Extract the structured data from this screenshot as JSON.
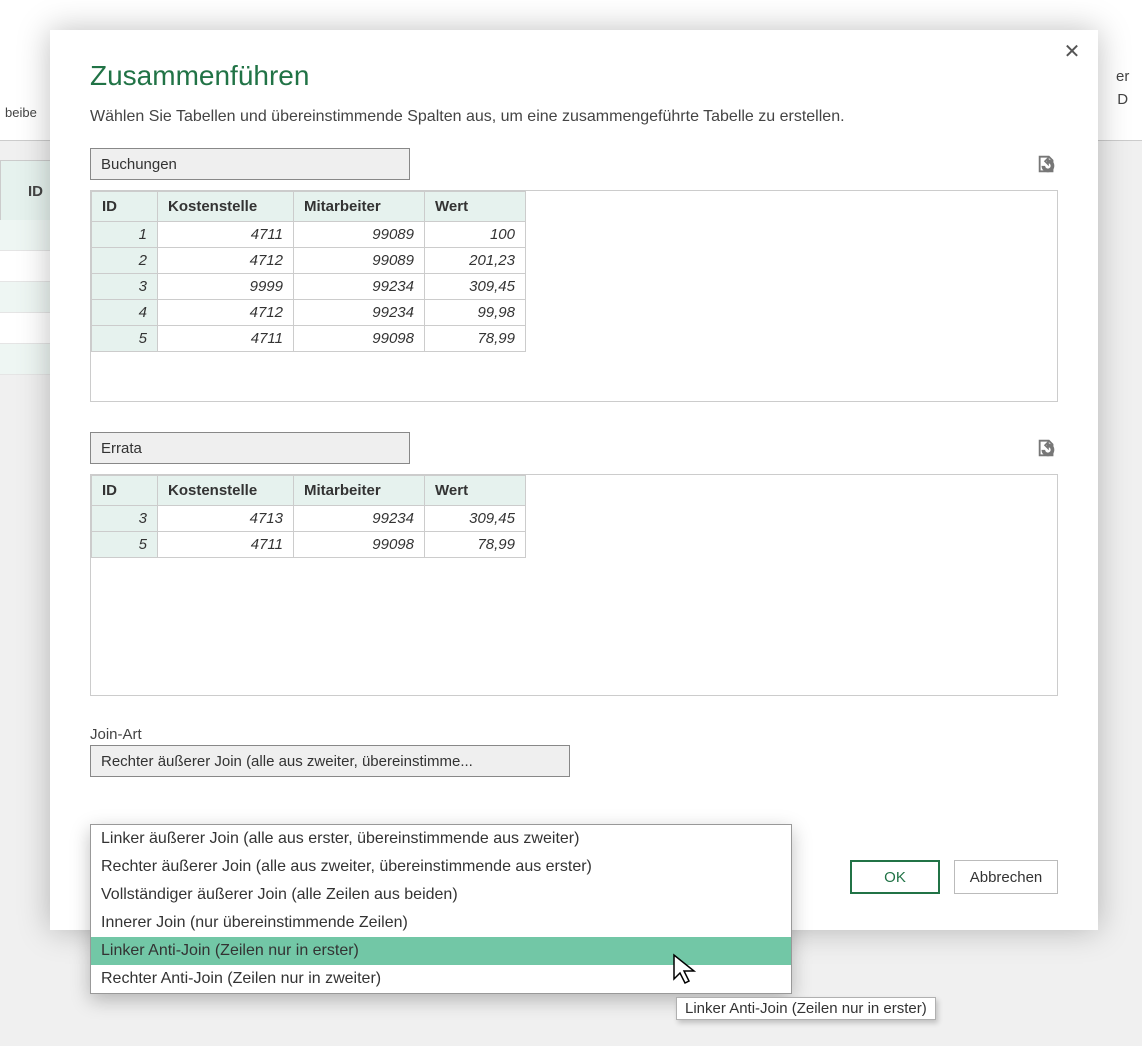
{
  "bg": {
    "ribbon_label": "beibe",
    "header": "ID"
  },
  "right": [
    "er",
    "D"
  ],
  "dialog": {
    "title": "Zusammenführen",
    "desc": "Wählen Sie Tabellen und übereinstimmende Spalten aus, um eine zusammengeführte Tabelle zu erstellen."
  },
  "table1": {
    "select": "Buchungen",
    "headers": [
      "ID",
      "Kostenstelle",
      "Mitarbeiter",
      "Wert"
    ],
    "rows": [
      [
        "1",
        "4711",
        "99089",
        "100"
      ],
      [
        "2",
        "4712",
        "99089",
        "201,23"
      ],
      [
        "3",
        "9999",
        "99234",
        "309,45"
      ],
      [
        "4",
        "4712",
        "99234",
        "99,98"
      ],
      [
        "5",
        "4711",
        "99098",
        "78,99"
      ]
    ]
  },
  "table2": {
    "select": "Errata",
    "headers": [
      "ID",
      "Kostenstelle",
      "Mitarbeiter",
      "Wert"
    ],
    "rows": [
      [
        "3",
        "4713",
        "99234",
        "309,45"
      ],
      [
        "5",
        "4711",
        "99098",
        "78,99"
      ]
    ]
  },
  "join": {
    "label": "Join-Art",
    "selected": "Rechter äußerer Join (alle aus zweiter, übereinstimme...",
    "options": [
      "Linker äußerer Join (alle aus erster, übereinstimmende aus zweiter)",
      "Rechter äußerer Join (alle aus zweiter, übereinstimmende aus erster)",
      "Vollständiger äußerer Join (alle Zeilen aus beiden)",
      "Innerer Join (nur übereinstimmende Zeilen)",
      "Linker Anti-Join (Zeilen nur in erster)",
      "Rechter Anti-Join (Zeilen nur in zweiter)"
    ],
    "highlight_index": 4
  },
  "buttons": {
    "ok": "OK",
    "cancel": "Abbrechen"
  },
  "tooltip": "Linker Anti-Join (Zeilen nur in erster)"
}
